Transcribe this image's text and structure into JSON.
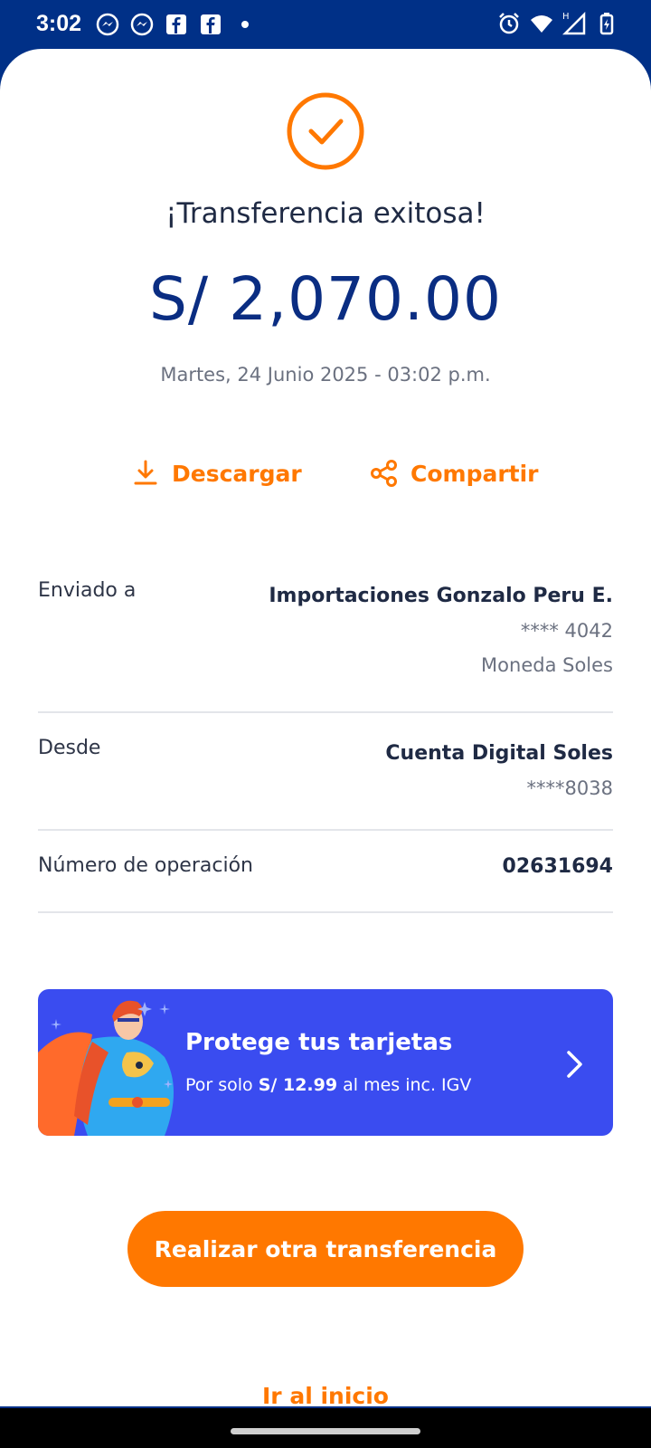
{
  "status_bar": {
    "time": "3:02",
    "left_icons": [
      "messenger-icon",
      "messenger-icon",
      "facebook-icon",
      "facebook-icon",
      "dot-icon"
    ],
    "right_icons": [
      "alarm-icon",
      "wifi-icon",
      "signal-icon",
      "battery-charging-icon"
    ],
    "network_label": "H"
  },
  "receipt": {
    "status_icon": "check-circle-icon",
    "title": "¡Transferencia exitosa!",
    "amount": "S/ 2,070.00",
    "datetime": "Martes, 24 Junio 2025 - 03:02 p.m."
  },
  "actions": {
    "download_label": "Descargar",
    "download_icon": "download-icon",
    "share_label": "Compartir",
    "share_icon": "share-icon"
  },
  "details": {
    "recipient": {
      "label": "Enviado a",
      "name": "Importaciones Gonzalo Peru E.",
      "account": "**** 4042",
      "currency": "Moneda Soles"
    },
    "source": {
      "label": "Desde",
      "account_name": "Cuenta Digital Soles",
      "account_number": "****8038"
    },
    "operation": {
      "label": "Número de operación",
      "value": "02631694"
    }
  },
  "promo": {
    "title": "Protege tus tarjetas",
    "subtitle_prefix": "Por solo ",
    "price": "S/ 12.99",
    "subtitle_suffix": " al mes inc. IGV",
    "icon": "chevron-right-icon"
  },
  "buttons": {
    "primary": "Realizar otra transferencia",
    "home": "Ir al inicio"
  },
  "colors": {
    "header_blue": "#003087",
    "amount_blue": "#0a2d82",
    "accent_orange": "#ff7800",
    "promo_blue": "#3a4cf0"
  }
}
